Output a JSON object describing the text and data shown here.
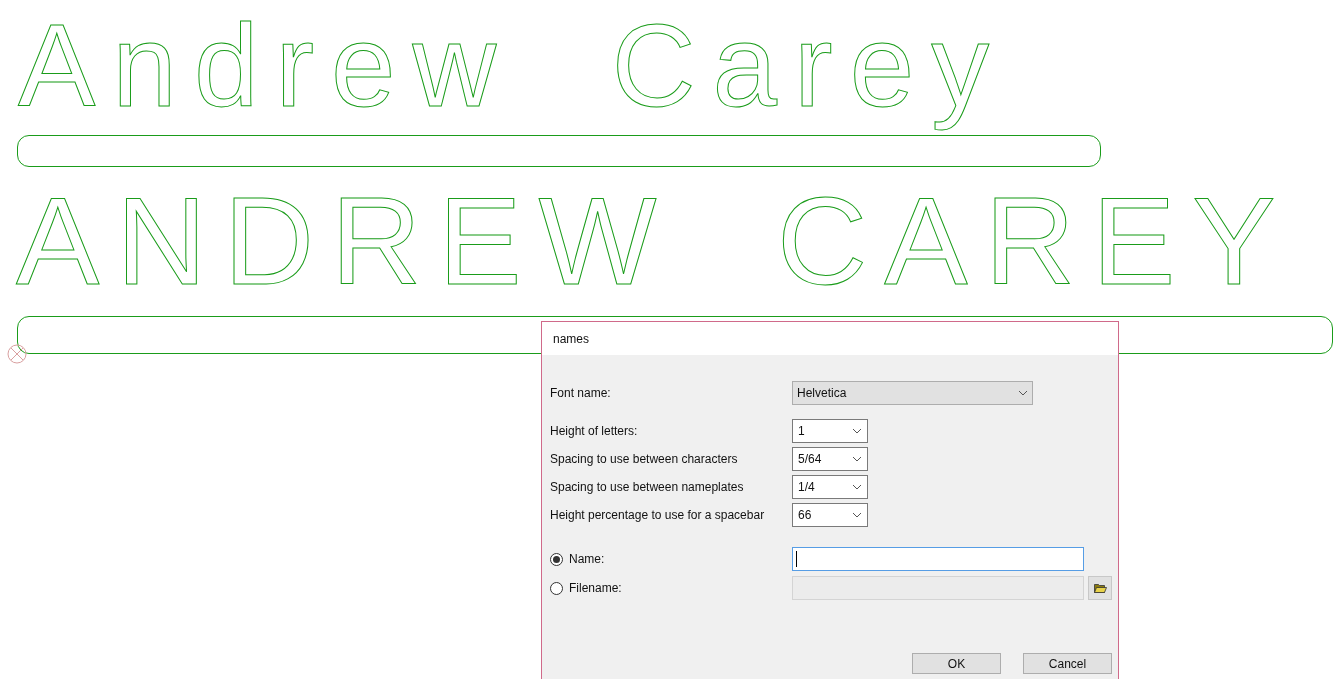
{
  "canvas": {
    "lines": [
      {
        "text": "Andrew  Carey"
      },
      {
        "text": "ANDREW  CAREY"
      }
    ]
  },
  "dialog": {
    "title": "names",
    "font": {
      "label": "Font name:",
      "value": "Helvetica"
    },
    "settings": [
      {
        "label": "Height of letters:",
        "value": "1"
      },
      {
        "label": "Spacing to use between characters",
        "value": "5/64"
      },
      {
        "label": "Spacing to use between nameplates",
        "value": "1/4"
      },
      {
        "label": "Height percentage to use for a spacebar",
        "value": "66"
      }
    ],
    "source": [
      {
        "label": "Name:",
        "selected": true
      },
      {
        "label": "Filename:",
        "selected": false
      }
    ],
    "buttons": [
      "OK",
      "Cancel"
    ]
  }
}
